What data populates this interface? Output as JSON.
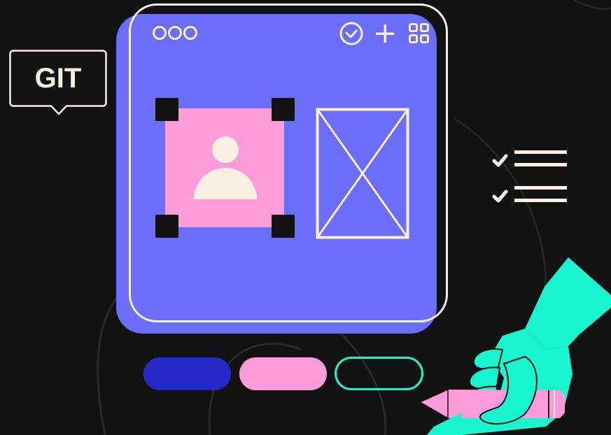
{
  "badge": {
    "label": "GIT"
  },
  "icons": {
    "window_dots": "three-circles-icon",
    "check": "check-circle-icon",
    "add": "plus-icon",
    "apps": "grid-icon",
    "profile": "user-icon",
    "image": "image-placeholder-icon",
    "tasks": "checklist-icon",
    "drawing": "hand-with-pencil"
  },
  "colors": {
    "background": "#121212",
    "window": "#6B6EFA",
    "frame": "#F7F0E1",
    "pink": "#FE9CDB",
    "navy": "#2429C8",
    "teal": "#18F5CF",
    "cream": "#F7F0E1"
  }
}
